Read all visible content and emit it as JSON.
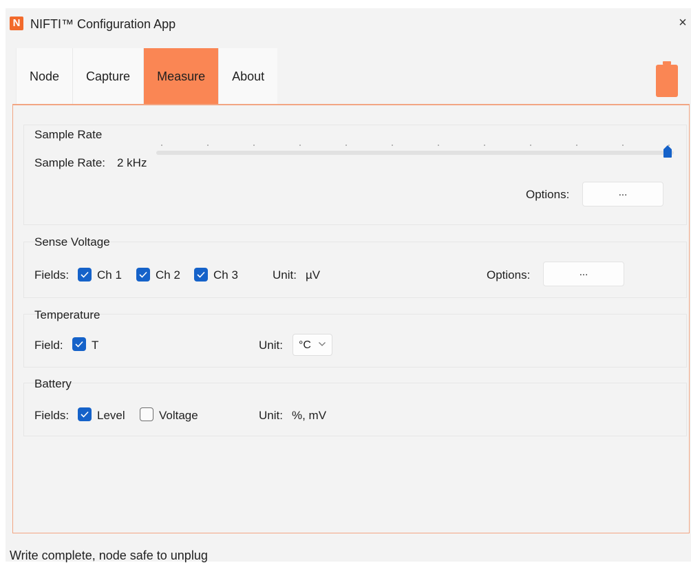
{
  "app": {
    "icon_letter": "N",
    "title": "NIFTI™ Configuration App",
    "close_glyph": "×"
  },
  "tabs": [
    {
      "label": "Node",
      "active": false
    },
    {
      "label": "Capture",
      "active": false
    },
    {
      "label": "Measure",
      "active": true
    },
    {
      "label": "About",
      "active": false
    }
  ],
  "accent_color": "#fa8654",
  "battery_icon": "battery-full-icon",
  "sample_rate": {
    "title": "Sample Rate",
    "label": "Sample Rate:",
    "value": "2 kHz",
    "slider_position_fraction": 1.0,
    "options_label": "Options:",
    "options_button": "..."
  },
  "sense_voltage": {
    "title": "Sense Voltage",
    "fields_label": "Fields:",
    "channels": [
      {
        "label": "Ch 1",
        "checked": true
      },
      {
        "label": "Ch 2",
        "checked": true
      },
      {
        "label": "Ch 3",
        "checked": true
      }
    ],
    "unit_label": "Unit:",
    "unit_value": "µV",
    "options_label": "Options:",
    "options_button": "..."
  },
  "temperature": {
    "title": "Temperature",
    "field_label": "Field:",
    "field": {
      "label": "T",
      "checked": true
    },
    "unit_label": "Unit:",
    "unit_selected": "°C"
  },
  "battery": {
    "title": "Battery",
    "fields_label": "Fields:",
    "fields": [
      {
        "label": "Level",
        "checked": true
      },
      {
        "label": "Voltage",
        "checked": false
      }
    ],
    "unit_label": "Unit:",
    "unit_value": "%, mV"
  },
  "status_bar": {
    "text": "Write complete, node safe to unplug"
  }
}
